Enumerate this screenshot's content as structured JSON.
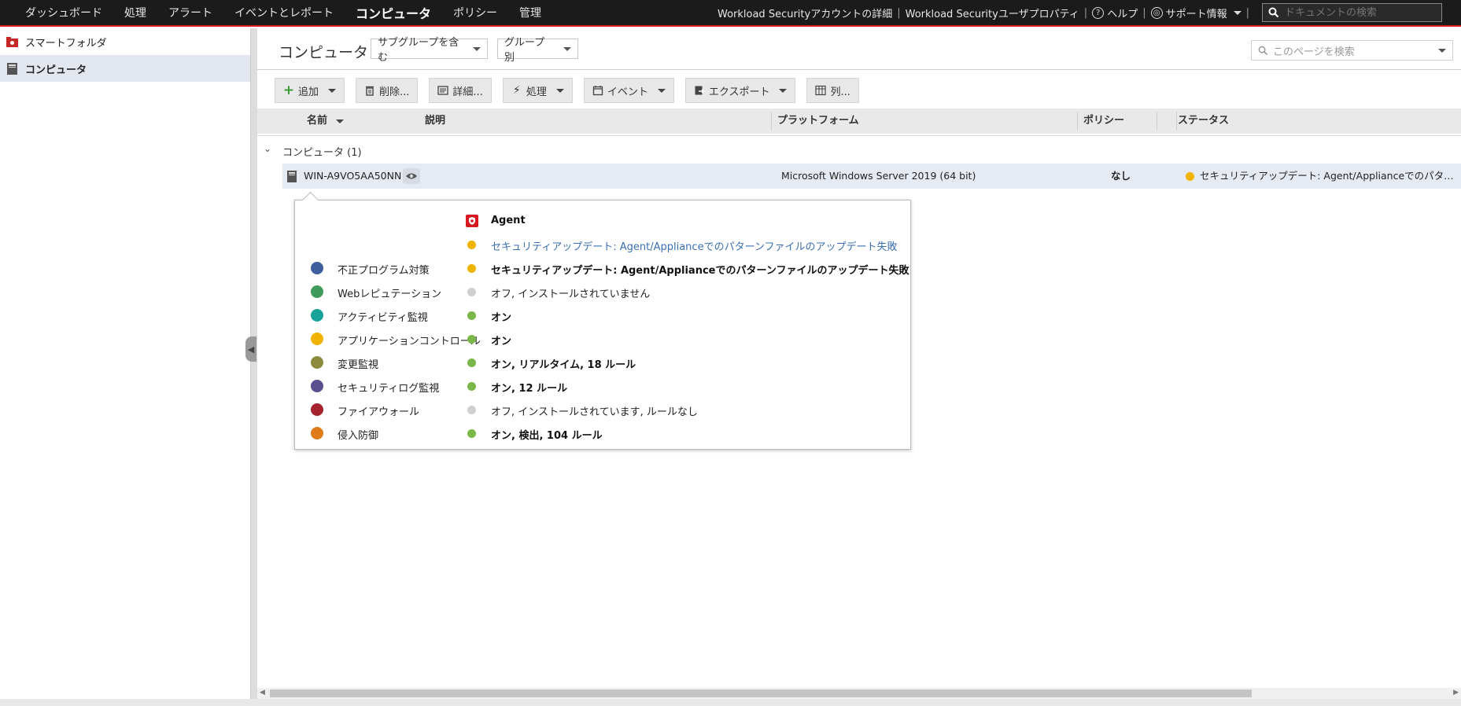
{
  "topnav": {
    "items": [
      "ダッシュボード",
      "処理",
      "アラート",
      "イベントとレポート",
      "コンピュータ",
      "ポリシー",
      "管理"
    ],
    "account_details": "Workload Securityアカウントの詳細",
    "user_properties": "Workload Securityユーザプロパティ",
    "help": "ヘルプ",
    "support": "サポート情報",
    "doc_search_placeholder": "ドキュメントの検索"
  },
  "sidebar": {
    "items": [
      {
        "label": "スマートフォルダ",
        "icon": "smart-folder-icon"
      },
      {
        "label": "コンピュータ",
        "icon": "computer-icon"
      }
    ]
  },
  "main": {
    "title": "コンピュータ",
    "subgroup_dropdown": "サブグループを含む",
    "group_dropdown": "グループ別",
    "page_search_placeholder": "このページを検索"
  },
  "toolbar": {
    "add": "追加",
    "delete": "削除...",
    "details": "詳細...",
    "actions": "処理",
    "events": "イベント",
    "export": "エクスポート",
    "columns": "列..."
  },
  "grid": {
    "headers": {
      "name": "名前",
      "description": "説明",
      "platform": "プラットフォーム",
      "policy": "ポリシー",
      "status": "ステータス"
    },
    "group_label": "コンピュータ (1)",
    "row": {
      "name": "WIN-A9VO5AA50NN",
      "description": "",
      "platform": "Microsoft Windows Server 2019 (64 bit)",
      "policy": "なし",
      "status": "セキュリティアップデート: Agent/Applianceでのパターンファイルのアップデート失敗"
    }
  },
  "popup": {
    "agent_label": "Agent",
    "agent_status": "セキュリティアップデート: Agent/Applianceでのパターンファイルのアップデート失敗",
    "modules": [
      {
        "name": "不正プログラム対策",
        "icon": "anti-malware-icon",
        "status": "セキュリティアップデート: Agent/Applianceでのパターンファイルのアップデート失敗",
        "state": "warning"
      },
      {
        "name": "Webレピュテーション",
        "icon": "web-reputation-icon",
        "status": "オフ, インストールされていません",
        "state": "off"
      },
      {
        "name": "アクティビティ監視",
        "icon": "activity-monitoring-icon",
        "status": "オン",
        "state": "on"
      },
      {
        "name": "アプリケーションコントロール",
        "icon": "application-control-icon",
        "status": "オン",
        "state": "on"
      },
      {
        "name": "変更監視",
        "icon": "integrity-monitoring-icon",
        "status": "オン, リアルタイム, 18 ルール",
        "state": "on"
      },
      {
        "name": "セキュリティログ監視",
        "icon": "log-inspection-icon",
        "status": "オン, 12 ルール",
        "state": "on"
      },
      {
        "name": "ファイアウォール",
        "icon": "firewall-icon",
        "status": "オフ, インストールされています, ルールなし",
        "state": "off"
      },
      {
        "name": "侵入防御",
        "icon": "intrusion-prevention-icon",
        "status": "オン, 検出, 104 ルール",
        "state": "on"
      }
    ]
  },
  "colors": {
    "accent": "#d71920",
    "warning": "#f0b400",
    "on": "#7ab648",
    "off": "#cfcfcf",
    "link": "#3a6fb0"
  }
}
